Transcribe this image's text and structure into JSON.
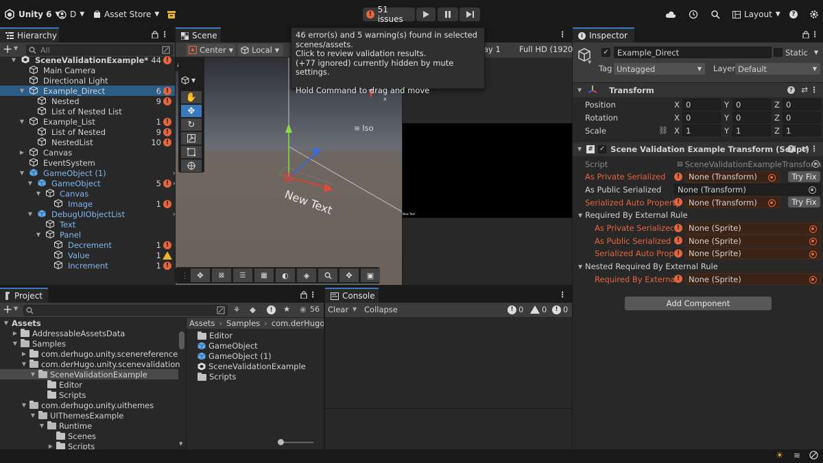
{
  "topbar": {
    "app_title": "Unity 6",
    "account": "D",
    "asset_store": "Asset Store",
    "issues": "51 issues",
    "layout": "Layout"
  },
  "hierarchy": {
    "tab": "Hierarchy",
    "search_placeholder": "All",
    "rows": [
      {
        "label": "SceneValidationExample*",
        "count": "44",
        "flag": "err"
      },
      {
        "label": "Main Camera",
        "count": "",
        "flag": ""
      },
      {
        "label": "Directional Light",
        "count": "",
        "flag": ""
      },
      {
        "label": "Example_Direct",
        "count": "6",
        "flag": "err"
      },
      {
        "label": "Nested",
        "count": "9",
        "flag": "err"
      },
      {
        "label": "List of Nested List",
        "count": "",
        "flag": ""
      },
      {
        "label": "Example_List",
        "count": "1",
        "flag": "err"
      },
      {
        "label": "List of Nested",
        "count": "9",
        "flag": "err"
      },
      {
        "label": "NestedList",
        "count": "10",
        "flag": "err"
      },
      {
        "label": "Canvas",
        "count": "",
        "flag": ""
      },
      {
        "label": "EventSystem",
        "count": "",
        "flag": ""
      },
      {
        "label": "GameObject (1)",
        "count": "",
        "flag": ""
      },
      {
        "label": "GameObject",
        "count": "5",
        "flag": "err"
      },
      {
        "label": "Canvas",
        "count": "",
        "flag": ""
      },
      {
        "label": "Image",
        "count": "1",
        "flag": "err"
      },
      {
        "label": "DebugUIObjectList",
        "count": "",
        "flag": ""
      },
      {
        "label": "Text",
        "count": "",
        "flag": ""
      },
      {
        "label": "Panel",
        "count": "",
        "flag": ""
      },
      {
        "label": "Decrement",
        "count": "1",
        "flag": "err"
      },
      {
        "label": "Value",
        "count": "1",
        "flag": "warn"
      },
      {
        "label": "Increment",
        "count": "1",
        "flag": "err"
      }
    ]
  },
  "scene": {
    "tab": "Scene",
    "pivot": "Center",
    "space": "Local",
    "canvas_frag": "as",
    "iso": "Iso",
    "new_text": "New Text",
    "new_text_small": "New Text",
    "game_display_frag": "ay 1",
    "game_res": "Full HD (1920x"
  },
  "tooltip": {
    "line1": "46 error(s) and 5 warning(s) found in selected",
    "line2": "scenes/assets.",
    "line3": "Click to review validation results.",
    "line4": "(+77 ignored) currently hidden by mute settings.",
    "line5": "Hold Command to drag and move"
  },
  "inspector": {
    "tab": "Inspector",
    "object_name": "Example_Direct",
    "static_label": "Static",
    "tag_label": "Tag",
    "tag_value": "Untagged",
    "layer_label": "Layer",
    "layer_value": "Default",
    "transform": {
      "title": "Transform",
      "position_label": "Position",
      "rotation_label": "Rotation",
      "scale_label": "Scale",
      "axis_x": "X",
      "axis_y": "Y",
      "axis_z": "Z",
      "position": [
        "0",
        "0",
        "0"
      ],
      "rotation": [
        "0",
        "0",
        "0"
      ],
      "scale": [
        "1",
        "1",
        "1"
      ]
    },
    "script_comp": {
      "title": "Scene Validation Example Transform (Script)",
      "script_label": "Script",
      "script_value": "SceneValidationExampleTransform",
      "rows": [
        {
          "label": "As Private Serialized",
          "value": "None (Transform)",
          "err": true,
          "fix": "Try Fix"
        },
        {
          "label": "As Public Serialized",
          "value": "None (Transform)",
          "err": false,
          "fix": ""
        },
        {
          "label": "Serialized Auto Property",
          "value": "None (Transform)",
          "err": true,
          "fix": "Try Fix"
        }
      ],
      "group1": "Required By External Rule",
      "group1_rows": [
        {
          "label": "As Private Serialized",
          "value": "None (Sprite)"
        },
        {
          "label": "As Public Serialized",
          "value": "None (Sprite)"
        },
        {
          "label": "Serialized Auto Prope",
          "value": "None (Sprite)"
        }
      ],
      "group2": "Nested Required By External Rule",
      "group2_rows": [
        {
          "label": "Required By External",
          "value": "None (Sprite)"
        }
      ]
    },
    "add_component": "Add Component"
  },
  "project": {
    "tab": "Project",
    "tree": [
      {
        "label": "Assets",
        "indent": 0,
        "arrow": "down",
        "bold": true,
        "folder": false
      },
      {
        "label": "AddressableAssetsData",
        "indent": 1,
        "arrow": "right",
        "folder": true
      },
      {
        "label": "Samples",
        "indent": 1,
        "arrow": "down",
        "folder": true
      },
      {
        "label": "com.derhugo.unity.scenereference",
        "indent": 2,
        "arrow": "right",
        "folder": true
      },
      {
        "label": "com.derHugo.unity.scenevalidation",
        "indent": 2,
        "arrow": "down",
        "folder": true
      },
      {
        "label": "SceneValidationExample",
        "indent": 3,
        "arrow": "down",
        "folder": true,
        "sel": true
      },
      {
        "label": "Editor",
        "indent": 4,
        "arrow": "",
        "folder": true
      },
      {
        "label": "Scripts",
        "indent": 4,
        "arrow": "",
        "folder": true
      },
      {
        "label": "com.derhugo.unity.uithemes",
        "indent": 2,
        "arrow": "down",
        "folder": true
      },
      {
        "label": "UIThemesExample",
        "indent": 3,
        "arrow": "down",
        "folder": true
      },
      {
        "label": "Runtime",
        "indent": 4,
        "arrow": "down",
        "folder": true
      },
      {
        "label": "Scenes",
        "indent": 5,
        "arrow": "",
        "folder": true
      },
      {
        "label": "Scripts",
        "indent": 5,
        "arrow": "right",
        "folder": true
      }
    ],
    "breadcrumb": [
      "Assets",
      "Samples",
      "com.derHugo.u"
    ],
    "assets": [
      {
        "label": "Editor",
        "type": "folder"
      },
      {
        "label": "GameObject",
        "type": "prefab"
      },
      {
        "label": "GameObject (1)",
        "type": "prefab"
      },
      {
        "label": "SceneValidationExample",
        "type": "scene"
      },
      {
        "label": "Scripts",
        "type": "folder"
      }
    ],
    "hidden_count": "56"
  },
  "console": {
    "tab": "Console",
    "clear": "Clear",
    "collapse": "Collapse",
    "info_count": "0",
    "warn_count": "0",
    "err_count": "0"
  },
  "colors": {
    "accent": "#3a79bb",
    "error": "#e5663d",
    "warning": "#e8b230",
    "selection": "#2c5d87"
  }
}
